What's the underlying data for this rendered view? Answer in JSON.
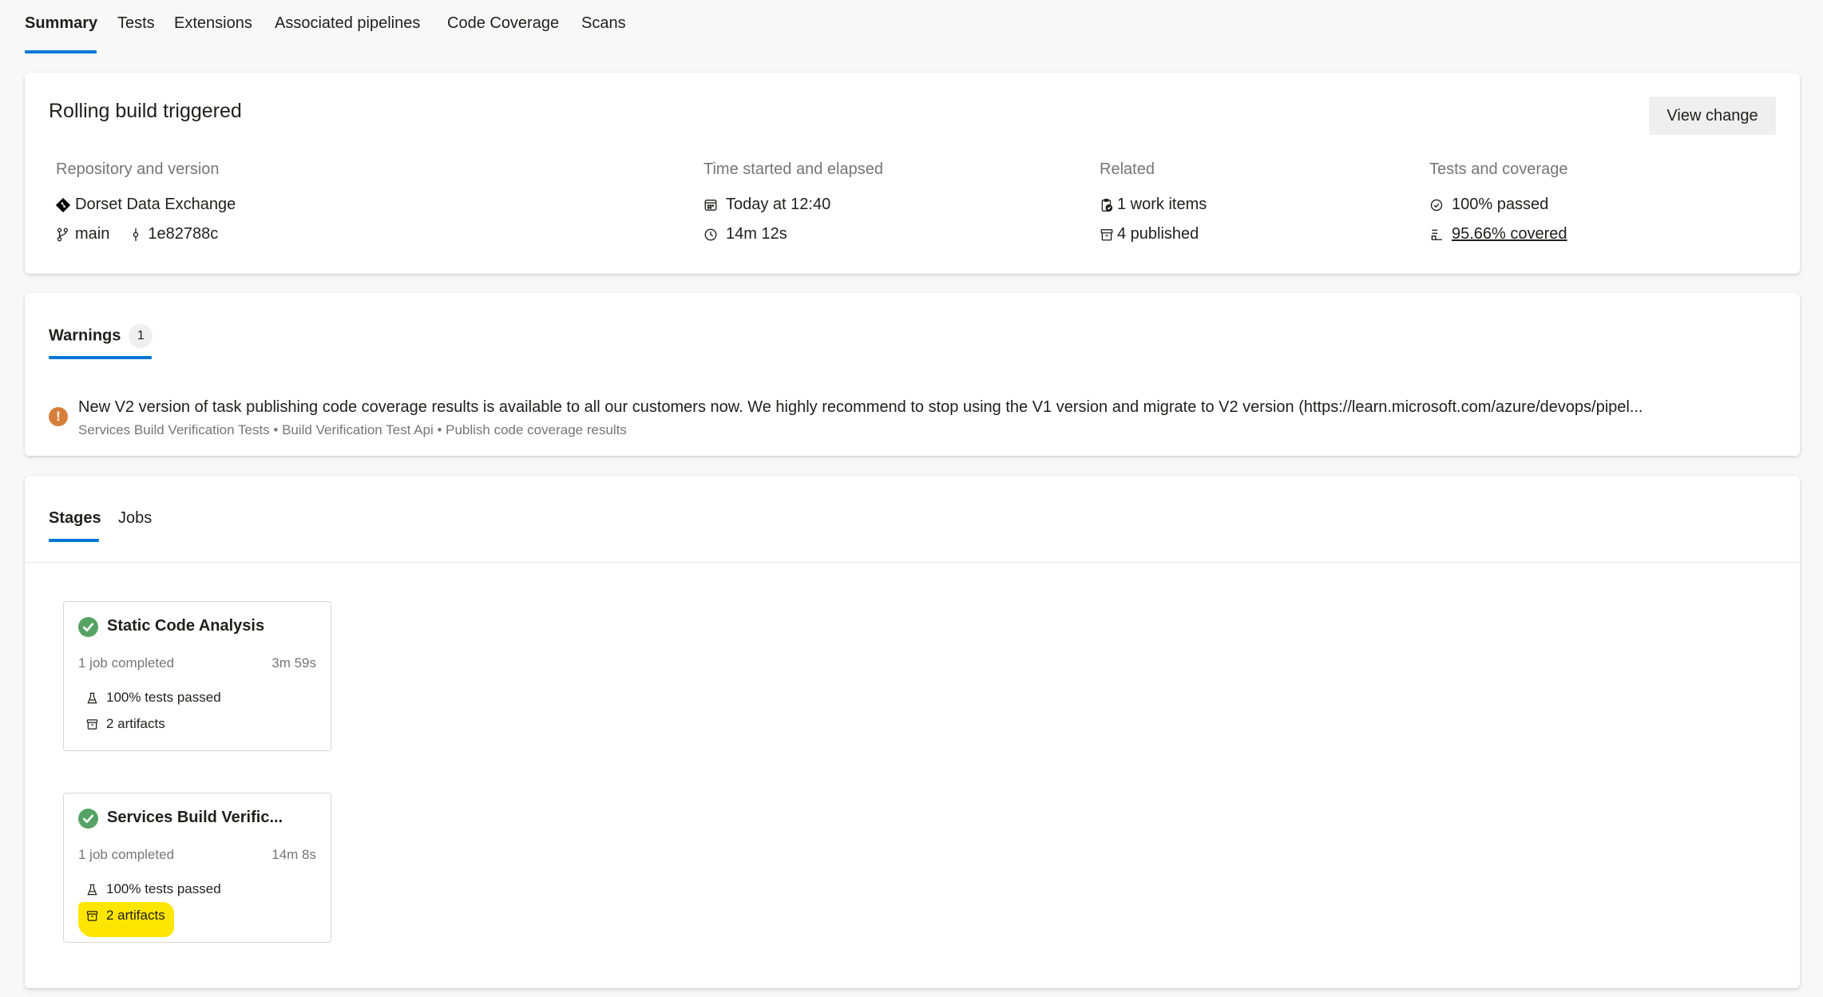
{
  "tabs": [
    {
      "label": "Summary",
      "active": true
    },
    {
      "label": "Tests"
    },
    {
      "label": "Extensions"
    },
    {
      "label": "Associated pipelines"
    },
    {
      "label": "Code Coverage"
    },
    {
      "label": "Scans"
    }
  ],
  "summary": {
    "title": "Rolling build triggered",
    "view_change_label": "View change",
    "repository": {
      "label": "Repository and version",
      "repo_name": "Dorset Data Exchange",
      "branch": "main",
      "commit": "1e82788c"
    },
    "time": {
      "label": "Time started and elapsed",
      "started": "Today at 12:40",
      "elapsed": "14m 12s"
    },
    "related": {
      "label": "Related",
      "work_items": "1 work items",
      "published": "4 published"
    },
    "tests": {
      "label": "Tests and coverage",
      "passed": "100% passed",
      "coverage": "95.66% covered"
    }
  },
  "warnings": {
    "tab_label": "Warnings",
    "count": "1",
    "items": [
      {
        "message": "New V2 version of task publishing code coverage results is available to all our customers now. We highly recommend to stop using the V1 version and migrate to V2 version (https://learn.microsoft.com/azure/devops/pipel...",
        "source": "Services Build Verification Tests • Build Verification Test Api • Publish code coverage results"
      }
    ]
  },
  "stages_section": {
    "tabs": [
      {
        "label": "Stages",
        "active": true
      },
      {
        "label": "Jobs"
      }
    ],
    "stages": [
      {
        "name": "Static Code Analysis",
        "status": "succeeded",
        "jobs": "1 job completed",
        "duration": "3m 59s",
        "tests": "100% tests passed",
        "artifacts": "2 artifacts",
        "highlighted": false
      },
      {
        "name": "Services Build Verific...",
        "status": "succeeded",
        "jobs": "1 job completed",
        "duration": "14m 8s",
        "tests": "100% tests passed",
        "artifacts": "2 artifacts",
        "highlighted": true
      }
    ]
  },
  "colors": {
    "accent": "#0078d4",
    "success": "#55a362",
    "warning": "#d67f3c",
    "highlight": "#ffe600"
  }
}
